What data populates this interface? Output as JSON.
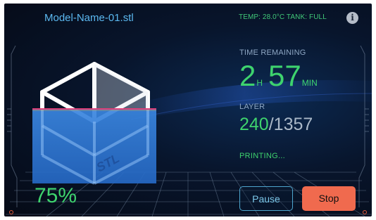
{
  "file": {
    "name": "Model-Name-01.stl"
  },
  "status_bar": {
    "text": "TEMP: 28.0°C  TANK: FULL"
  },
  "info_icon": {
    "glyph": "i",
    "icon": "info-icon"
  },
  "time_remaining": {
    "label": "TIME REMAINING",
    "hours": "2",
    "hours_unit": "H",
    "minutes": "57",
    "minutes_unit": "MIN"
  },
  "layer": {
    "label": "LAYER",
    "current": "240",
    "separator": "/",
    "total": "1357"
  },
  "print_status": "PRINTING...",
  "model": {
    "label": "STL"
  },
  "progress": {
    "percent_text": "75%",
    "fraction": 0.75
  },
  "buttons": {
    "pause": "Pause",
    "stop": "Stop"
  },
  "colors": {
    "accent_green": "#3ed36e",
    "accent_blue": "#5bb8f0",
    "stop_button": "#f06a4e",
    "fill_blue": "#2f7ad6",
    "level_line": "#e0407a"
  }
}
